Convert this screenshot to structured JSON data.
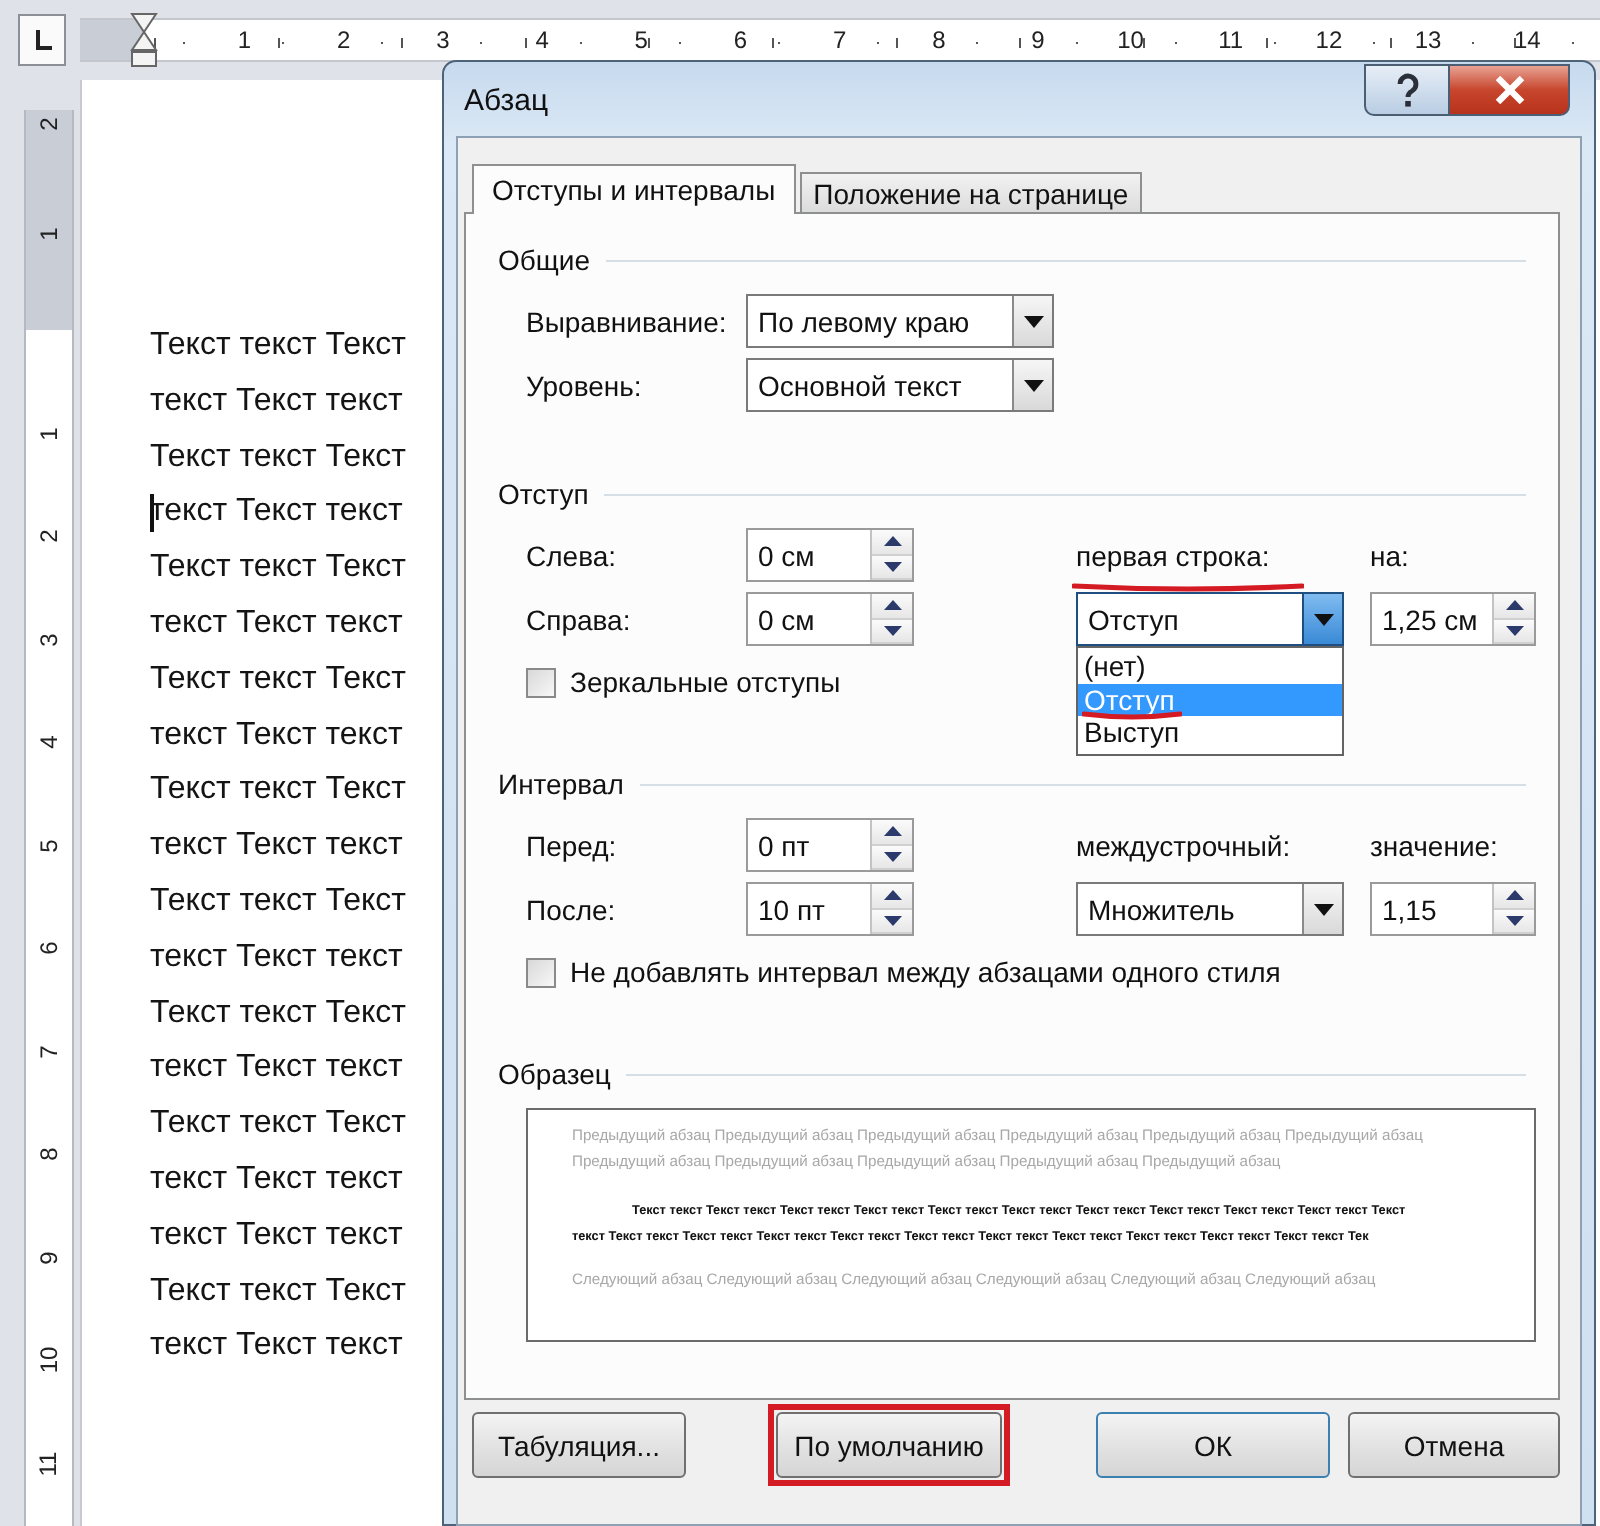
{
  "ruler": {
    "horizontal_marks": [
      "1",
      "2",
      "3",
      "4",
      "5",
      "6",
      "7",
      "8",
      "9",
      "10",
      "11",
      "12",
      "13",
      "14"
    ],
    "vertical_margin_marks": [
      "2",
      "1"
    ],
    "vertical_marks": [
      "1",
      "2",
      "3",
      "4",
      "5",
      "6",
      "7",
      "8",
      "9",
      "10",
      "11"
    ]
  },
  "document": {
    "lines": [
      {
        "text": "Текст текст Текст",
        "caret": false
      },
      {
        "text": "текст Текст текст",
        "caret": false
      },
      {
        "text": "Текст текст Текст",
        "caret": false
      },
      {
        "text": "текст Текст текст",
        "caret": true
      },
      {
        "text": "Текст текст Текст",
        "caret": false
      },
      {
        "text": "текст Текст текст",
        "caret": false
      },
      {
        "text": "Текст текст Текст",
        "caret": false
      },
      {
        "text": "текст Текст текст",
        "caret": false
      },
      {
        "text": "Текст текст Текст",
        "caret": false
      },
      {
        "text": "текст Текст текст",
        "caret": false
      },
      {
        "text": "Текст текст Текст",
        "caret": false
      },
      {
        "text": "текст Текст текст",
        "caret": false
      },
      {
        "text": "Текст текст Текст",
        "caret": false
      },
      {
        "text": "текст Текст текст",
        "caret": false
      },
      {
        "text": "Текст текст Текст",
        "caret": false
      },
      {
        "text": "текст Текст текст",
        "caret": false
      },
      {
        "text": "текст Текст текст",
        "caret": false
      },
      {
        "text": "Текст текст Текст",
        "caret": false
      },
      {
        "text": "текст Текст текст",
        "caret": false
      }
    ]
  },
  "dialog": {
    "title": "Абзац",
    "tabs": [
      {
        "label": "Отступы и интервалы",
        "selected": true
      },
      {
        "label": "Положение на странице",
        "selected": false
      }
    ],
    "sections": [
      {
        "heading": "Общие",
        "rows": [
          {
            "cells": [
              {
                "kind": "label",
                "text": "Выравнивание:"
              },
              {
                "kind": "select",
                "value": "По левому краю",
                "focused": false
              }
            ]
          },
          {
            "cells": [
              {
                "kind": "label",
                "text": "Уровень:"
              },
              {
                "kind": "select",
                "value": "Основной текст",
                "focused": false
              }
            ]
          }
        ]
      },
      {
        "heading": "Отступ",
        "rows": [
          {
            "cells": [
              {
                "kind": "label",
                "text": "Слева:"
              },
              {
                "kind": "spin",
                "value": "0 см"
              },
              {
                "kind": "label",
                "text": "первая строка:",
                "annotated": true
              },
              {
                "kind": "label",
                "text": "на:"
              }
            ]
          },
          {
            "cells": [
              {
                "kind": "label",
                "text": "Справа:"
              },
              {
                "kind": "spin",
                "value": "0 см"
              },
              {
                "kind": "select",
                "value": "Отступ",
                "focused": true,
                "expanded": true,
                "options": [
                  {
                    "label": "(нет)",
                    "selected": false,
                    "annotated": false
                  },
                  {
                    "label": "Отступ",
                    "selected": true,
                    "annotated": true
                  },
                  {
                    "label": "Выступ",
                    "selected": false,
                    "annotated": false
                  }
                ]
              },
              {
                "kind": "spin",
                "value": "1,25 см"
              }
            ]
          },
          {
            "cells": [
              {
                "kind": "checkbox",
                "label": "Зеркальные отступы",
                "checked": false
              }
            ]
          }
        ]
      },
      {
        "heading": "Интервал",
        "rows": [
          {
            "cells": [
              {
                "kind": "label",
                "text": "Перед:"
              },
              {
                "kind": "spin",
                "value": "0 пт"
              },
              {
                "kind": "label",
                "text": "междустрочный:"
              },
              {
                "kind": "label",
                "text": "значение:"
              }
            ]
          },
          {
            "cells": [
              {
                "kind": "label",
                "text": "После:"
              },
              {
                "kind": "spin",
                "value": "10 пт"
              },
              {
                "kind": "select",
                "value": "Множитель",
                "focused": false
              },
              {
                "kind": "spin",
                "value": "1,15"
              }
            ]
          },
          {
            "cells": [
              {
                "kind": "checkbox",
                "label": "Не добавлять интервал между абзацами одного стиля",
                "checked": false
              }
            ]
          }
        ]
      }
    ],
    "preview": {
      "heading": "Образец",
      "previous": "Предыдущий абзац Предыдущий абзац Предыдущий абзац Предыдущий абзац Предыдущий абзац Предыдущий абзац Предыдущий абзац Предыдущий абзац Предыдущий абзац Предыдущий абзац Предыдущий абзац",
      "current": "Текст текст Текст текст Текст текст Текст текст Текст текст Текст текст Текст текст Текст текст Текст текст Текст текст Текст текст Текст текст Текст текст Текст текст Текст текст Текст текст Текст текст Текст текст Текст текст Текст текст Текст текст Тек",
      "next": "Следующий абзац Следующий абзац Следующий абзац Следующий абзац Следующий абзац Следующий абзац"
    },
    "buttons": [
      {
        "label": "Табуляция...",
        "annotated": false
      },
      {
        "label": "По умолчанию",
        "annotated": true
      },
      {
        "label": "ОК",
        "annotated": false
      },
      {
        "label": "Отмена",
        "annotated": false
      }
    ]
  }
}
